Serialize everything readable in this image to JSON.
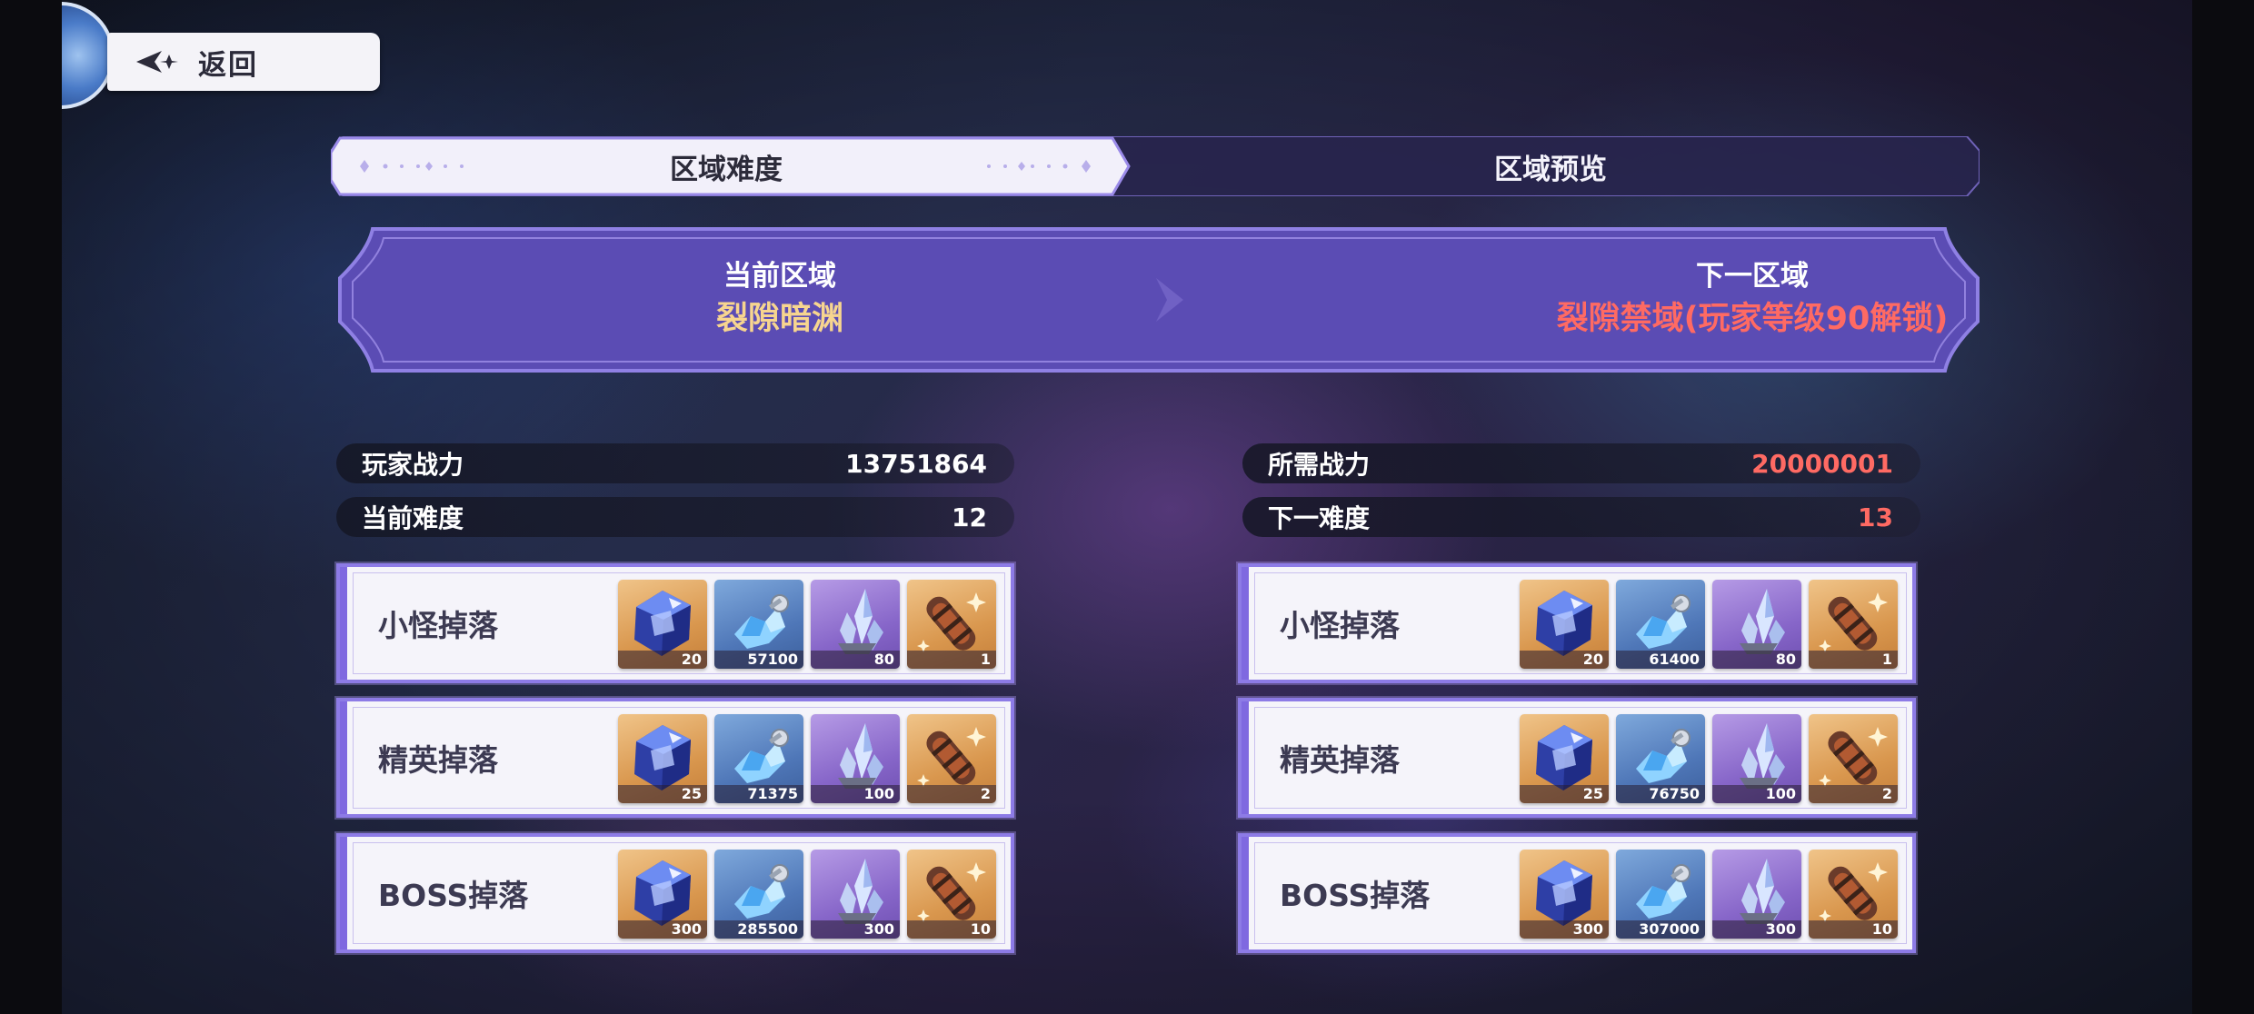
{
  "header": {
    "back_label": "返回"
  },
  "tabs": [
    {
      "label": "区域难度",
      "active": true
    },
    {
      "label": "区域预览",
      "active": false
    }
  ],
  "region": {
    "current_caption": "当前区域",
    "current_name": "裂隙暗渊",
    "next_caption": "下一区域",
    "next_name": "裂隙禁域(玩家等级90解锁)"
  },
  "left_stats": {
    "power_label": "玩家战力",
    "power_value": "13751864",
    "difficulty_label": "当前难度",
    "difficulty_value": "12"
  },
  "right_stats": {
    "power_label": "所需战力",
    "power_value": "20000001",
    "difficulty_label": "下一难度",
    "difficulty_value": "13"
  },
  "left_drops": [
    {
      "title": "小怪掉落",
      "items": [
        {
          "icon": "crystal-cube-icon",
          "qty": "20"
        },
        {
          "icon": "blue-crystal-icon",
          "qty": "57100"
        },
        {
          "icon": "purple-shard-icon",
          "qty": "80"
        },
        {
          "icon": "capsule-icon",
          "qty": "1"
        }
      ]
    },
    {
      "title": "精英掉落",
      "items": [
        {
          "icon": "crystal-cube-icon",
          "qty": "25"
        },
        {
          "icon": "blue-crystal-icon",
          "qty": "71375"
        },
        {
          "icon": "purple-shard-icon",
          "qty": "100"
        },
        {
          "icon": "capsule-icon",
          "qty": "2"
        }
      ]
    },
    {
      "title": "BOSS掉落",
      "items": [
        {
          "icon": "crystal-cube-icon",
          "qty": "300"
        },
        {
          "icon": "blue-crystal-icon",
          "qty": "285500"
        },
        {
          "icon": "purple-shard-icon",
          "qty": "300"
        },
        {
          "icon": "capsule-icon",
          "qty": "10"
        }
      ]
    }
  ],
  "right_drops": [
    {
      "title": "小怪掉落",
      "items": [
        {
          "icon": "crystal-cube-icon",
          "qty": "20"
        },
        {
          "icon": "blue-crystal-icon",
          "qty": "61400"
        },
        {
          "icon": "purple-shard-icon",
          "qty": "80"
        },
        {
          "icon": "capsule-icon",
          "qty": "1"
        }
      ]
    },
    {
      "title": "精英掉落",
      "items": [
        {
          "icon": "crystal-cube-icon",
          "qty": "25"
        },
        {
          "icon": "blue-crystal-icon",
          "qty": "76750"
        },
        {
          "icon": "purple-shard-icon",
          "qty": "100"
        },
        {
          "icon": "capsule-icon",
          "qty": "2"
        }
      ]
    },
    {
      "title": "BOSS掉落",
      "items": [
        {
          "icon": "crystal-cube-icon",
          "qty": "300"
        },
        {
          "icon": "blue-crystal-icon",
          "qty": "307000"
        },
        {
          "icon": "purple-shard-icon",
          "qty": "300"
        },
        {
          "icon": "capsule-icon",
          "qty": "10"
        }
      ]
    }
  ],
  "colors": {
    "accent": "#7f69e0",
    "gold_text": "#f7d58f",
    "red_text": "#ff6a63"
  }
}
